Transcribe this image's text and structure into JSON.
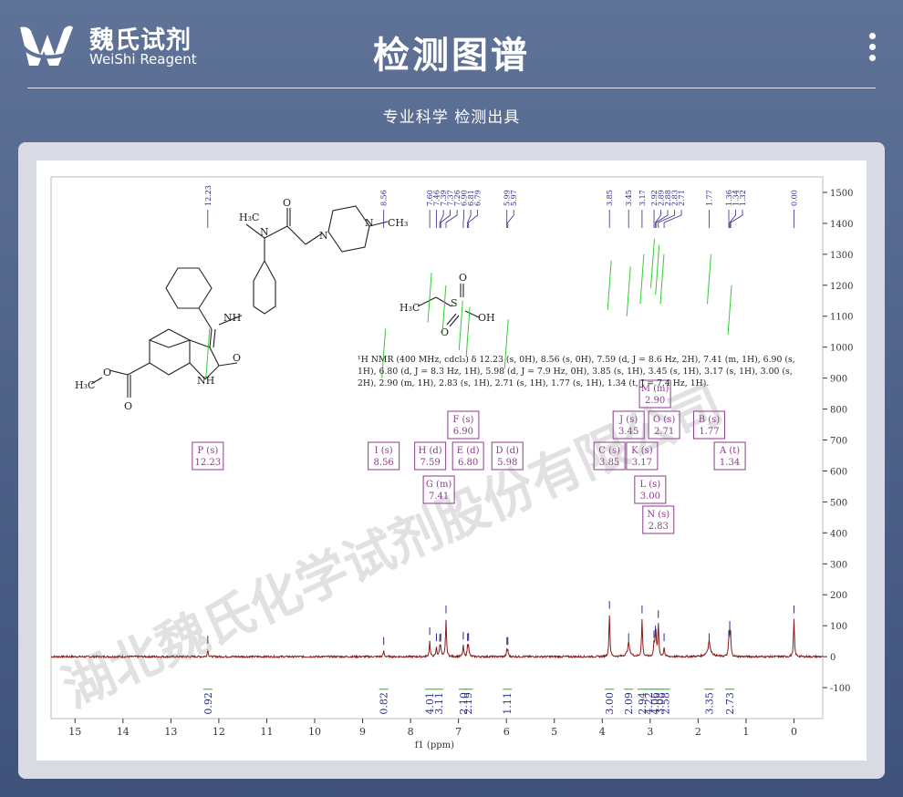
{
  "header": {
    "brand_cn": "魏氏试剂",
    "brand_en": "WeiShi Reagent",
    "title": "检测图谱",
    "subtitle": "专业科学  检测出具"
  },
  "watermark": "湖北魏氏化学试剂股份有限公司",
  "colors": {
    "spectrum": "#8b1a1a",
    "peak_label": "#2b2b8c",
    "integral": "#33cc33",
    "box": "#8e3a8e",
    "atom_red": "#cc2222"
  },
  "chart_data": {
    "type": "line",
    "xlabel": "f1 (ppm)",
    "xlim": [
      15.5,
      -0.6
    ],
    "ylim": [
      -200,
      1550
    ],
    "x_ticks": [
      "15",
      "14",
      "13",
      "12",
      "11",
      "10",
      "9",
      "8",
      "7",
      "6",
      "5",
      "4",
      "3",
      "2",
      "1",
      "0"
    ],
    "y_ticks": [
      "1500",
      "1400",
      "1300",
      "1200",
      "1100",
      "1000",
      "900",
      "800",
      "700",
      "600",
      "500",
      "400",
      "300",
      "200",
      "100",
      "0",
      "-100"
    ],
    "peaks": [
      {
        "ppm": 12.23,
        "h": 22
      },
      {
        "ppm": 8.56,
        "h": 18
      },
      {
        "ppm": 7.6,
        "h": 50
      },
      {
        "ppm": 7.46,
        "h": 30
      },
      {
        "ppm": 7.39,
        "h": 28
      },
      {
        "ppm": 7.37,
        "h": 30
      },
      {
        "ppm": 7.26,
        "h": 120
      },
      {
        "ppm": 6.9,
        "h": 35
      },
      {
        "ppm": 6.81,
        "h": 30
      },
      {
        "ppm": 6.79,
        "h": 32
      },
      {
        "ppm": 5.99,
        "h": 18
      },
      {
        "ppm": 5.97,
        "h": 18
      },
      {
        "ppm": 3.85,
        "h": 135
      },
      {
        "ppm": 3.45,
        "h": 30
      },
      {
        "ppm": 3.17,
        "h": 120
      },
      {
        "ppm": 2.92,
        "h": 40
      },
      {
        "ppm": 2.89,
        "h": 55
      },
      {
        "ppm": 2.88,
        "h": 45
      },
      {
        "ppm": 2.83,
        "h": 105
      },
      {
        "ppm": 2.71,
        "h": 30
      },
      {
        "ppm": 1.77,
        "h": 30
      },
      {
        "ppm": 1.36,
        "h": 40
      },
      {
        "ppm": 1.34,
        "h": 70
      },
      {
        "ppm": 1.32,
        "h": 40
      },
      {
        "ppm": 0.0,
        "h": 120
      }
    ],
    "peak_labels": [
      "12.23",
      "8.56",
      "7.60",
      "7.46",
      "7.39",
      "7.37",
      "7.26",
      "6.90",
      "6.81",
      "6.79",
      "5.99",
      "5.97",
      "3.85",
      "3.45",
      "3.17",
      "2.92",
      "2.89",
      "2.88",
      "2.83",
      "2.71",
      "1.77",
      "1.36",
      "1.34",
      "1.32",
      "0.00"
    ],
    "integrals": [
      {
        "ppm": 12.23,
        "value": "0.92"
      },
      {
        "ppm": 8.56,
        "value": "0.82"
      },
      {
        "ppm": 7.6,
        "value": "4.01"
      },
      {
        "ppm": 7.41,
        "value": "3.11"
      },
      {
        "ppm": 6.9,
        "value": "2.10"
      },
      {
        "ppm": 6.8,
        "value": "2.19"
      },
      {
        "ppm": 5.98,
        "value": "1.11"
      },
      {
        "ppm": 3.85,
        "value": "3.00"
      },
      {
        "ppm": 3.45,
        "value": "2.09"
      },
      {
        "ppm": 3.17,
        "value": "2.94"
      },
      {
        "ppm": 3.03,
        "value": "4.22"
      },
      {
        "ppm": 2.9,
        "value": "4.06"
      },
      {
        "ppm": 2.8,
        "value": "3.08"
      },
      {
        "ppm": 2.68,
        "value": "2.58"
      },
      {
        "ppm": 1.77,
        "value": "3.35"
      },
      {
        "ppm": 1.34,
        "value": "2.73"
      }
    ],
    "multiplets": [
      {
        "id": "P",
        "mult": "s",
        "shift": "12.23",
        "ppm": 12.23,
        "y": 485
      },
      {
        "id": "I",
        "mult": "s",
        "shift": "8.56",
        "ppm": 8.56,
        "y": 485
      },
      {
        "id": "H",
        "mult": "d",
        "shift": "7.59",
        "ppm": 7.59,
        "y": 485
      },
      {
        "id": "G",
        "mult": "m",
        "shift": "7.41",
        "ppm": 7.41,
        "y": 522
      },
      {
        "id": "F",
        "mult": "s",
        "shift": "6.90",
        "ppm": 6.9,
        "y": 451
      },
      {
        "id": "E",
        "mult": "d",
        "shift": "6.80",
        "ppm": 6.8,
        "y": 485
      },
      {
        "id": "D",
        "mult": "d",
        "shift": "5.98",
        "ppm": 5.98,
        "y": 485
      },
      {
        "id": "C",
        "mult": "s",
        "shift": "3.85",
        "ppm": 3.85,
        "y": 485
      },
      {
        "id": "J",
        "mult": "s",
        "shift": "3.45",
        "ppm": 3.45,
        "y": 451
      },
      {
        "id": "K",
        "mult": "s",
        "shift": "3.17",
        "ppm": 3.17,
        "y": 485
      },
      {
        "id": "L",
        "mult": "s",
        "shift": "3.00",
        "ppm": 3.0,
        "y": 522
      },
      {
        "id": "N",
        "mult": "s",
        "shift": "2.83",
        "ppm": 2.83,
        "y": 555
      },
      {
        "id": "M",
        "mult": "m",
        "shift": "2.90",
        "ppm": 2.9,
        "y": 417
      },
      {
        "id": "O",
        "mult": "s",
        "shift": "2.71",
        "ppm": 2.71,
        "y": 451
      },
      {
        "id": "B",
        "mult": "s",
        "shift": "1.77",
        "ppm": 1.77,
        "y": 451
      },
      {
        "id": "A",
        "mult": "t",
        "shift": "1.34",
        "ppm": 1.34,
        "y": 485
      }
    ],
    "nmr_text": [
      "¹H NMR (400 MHz, cdcl₃) δ 12.23 (s, 0H), 8.56 (s, 0H), 7.59 (d, J = 8.6 Hz, 2H), 7.41 (m, 1H), 6.90 (s,",
      "1H), 6.80 (d, J = 8.3 Hz, 1H), 5.98 (d, J = 7.9 Hz, 0H), 3.85 (s, 1H), 3.45 (s, 1H), 3.17 (s, 1H), 3.00 (s,",
      "2H), 2.90 (m, 1H), 2.83 (s, 1H), 2.71 (s, 1H), 1.77 (s, 1H), 1.34 (t, J = 7.4 Hz, 1H)."
    ]
  }
}
